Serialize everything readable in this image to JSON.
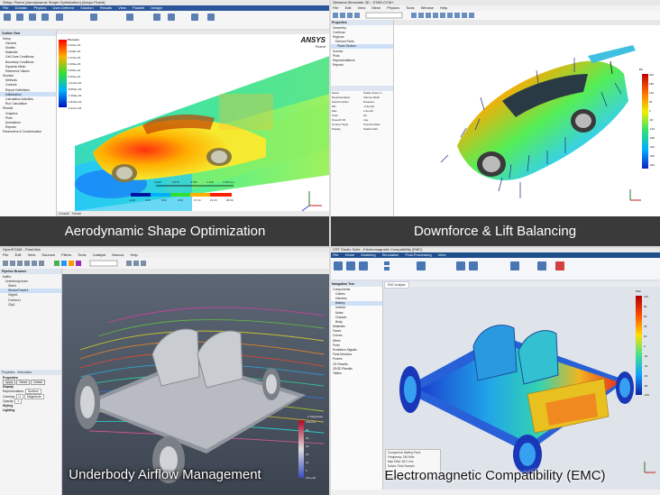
{
  "q1": {
    "title": "Setup: Fluent (Aerodynamic Shape Optimization) [Ansys Fluent]",
    "tabs": [
      "File",
      "Domain",
      "Physics",
      "User-Defined",
      "Solution",
      "Results",
      "View",
      "Parallel",
      "Design"
    ],
    "panel_title": "Outline View",
    "tree": [
      "Setup",
      "General",
      "Models",
      "Materials",
      "Cell Zone Conditions",
      "Boundary Conditions",
      "Dynamic Mesh",
      "Reference Values",
      "Solution",
      "Methods",
      "Controls",
      "Report Definitions",
      "Initialization",
      "Calculation Activities",
      "Run Calculation",
      "Results",
      "Graphics",
      "Plots",
      "Animations",
      "Reports",
      "Parameters & Customization"
    ],
    "view_tab": "Mesh",
    "brand": "ANSYS",
    "brand_sub": "Fluent",
    "legend_title": "Pressure",
    "legend_values": [
      "2.422e+03",
      "1.948e+03",
      "1.474e+03",
      "1.000e+03",
      "5.265e+02",
      "5.264e+01",
      "-4.212e+02",
      "-8.952e+02",
      "-1.369e+03",
      "-1.843e+03",
      "-2.317e+03"
    ],
    "scale_ticks": [
      "0.000",
      "0.375",
      "0.750",
      "1.125",
      "1.500 (m)"
    ],
    "bottom_ticks": [
      "-1.00",
      "2.00",
      "0.00",
      "2.00",
      "17.14",
      "21.15",
      "28.00"
    ],
    "bottom_tabs": [
      "Console",
      "Tutorial"
    ],
    "caption": "Aerodynamic Shape Optimization"
  },
  "q2": {
    "title": "Siemens Simcenter 3D - STAR-CCM+",
    "menu": [
      "File",
      "Edit",
      "View",
      "Mesh",
      "Physics",
      "Tools",
      "Window",
      "Help"
    ],
    "panel_title": "Properties",
    "tree": [
      "Geometry",
      "Continua",
      "Regions",
      "Derived Parts",
      "Plane Section",
      "Scenes",
      "Plots",
      "Representations",
      "Reports"
    ],
    "props": [
      [
        "Name",
        "Scalar Scene 1"
      ],
      [
        "Representation",
        "Volume Mesh"
      ],
      [
        "Field Function",
        "Pressure"
      ],
      [
        "Min",
        "-3.4e+02"
      ],
      [
        "Max",
        "2.4e+02"
      ],
      [
        "Units",
        "Pa"
      ],
      [
        "Smooth Fill",
        "true"
      ],
      [
        "Contour Style",
        "Smooth Filled"
      ],
      [
        "Display",
        "Scalar Field"
      ]
    ],
    "legend_title": "Pa",
    "legend_values": [
      "240",
      "180",
      "120",
      "60",
      "0",
      "-60",
      "-120",
      "-180",
      "-240",
      "-300",
      "-340"
    ],
    "caption": "Downforce & Lift Balancing"
  },
  "q3": {
    "title": "OpenFOAM - ParaView",
    "menu": [
      "File",
      "Edit",
      "View",
      "Sources",
      "Filters",
      "Tools",
      "Catalyst",
      "Macros",
      "Help"
    ],
    "panel_title": "Pipeline Browser",
    "tree": [
      "builtin:",
      "Underbody.foam",
      "Slice1",
      "StreamTracer1",
      "Glyph1",
      "Contour1",
      "Clip1"
    ],
    "prop_tabs": [
      "Properties",
      "Information"
    ],
    "props": [
      "Properties",
      "Apply",
      "Reset",
      "Delete",
      "Display",
      "Representation",
      "Surface",
      "Coloring",
      "U",
      "Magnitude",
      "Opacity",
      "1",
      "Styling",
      "Lighting"
    ],
    "legend_title": "U Magnitude",
    "legend_values": [
      "3.5e+01",
      "30",
      "25",
      "20",
      "15",
      "10",
      "5",
      "0.0e+00"
    ],
    "caption": "Underbody Airflow Management"
  },
  "q4": {
    "title": "CST Studio Suite - Electromagnetic Compatibility (EMC)",
    "tabs": [
      "File",
      "Home",
      "Modeling",
      "Simulation",
      "Post-Processing",
      "View"
    ],
    "panel_title": "Navigation Tree",
    "tree": [
      "Components",
      "Cables",
      "Harness",
      "Battery",
      "Inverter",
      "Motor",
      "Chassis",
      "Body",
      "Materials",
      "Faces",
      "Curves",
      "Wires",
      "Ports",
      "Excitation Signals",
      "Field Monitors",
      "Probes",
      "1D Results",
      "2D/3D Results",
      "Tables"
    ],
    "view_tab": "EMC Analysis",
    "legend_title": "V/m",
    "legend_values": [
      "100",
      "80",
      "60",
      "40",
      "20",
      "0",
      "-20",
      "-40",
      "-60",
      "-80",
      "-100"
    ],
    "info_rows": [
      "Component: Battery Pack",
      "Frequency: 150 MHz",
      "Max Field: 98.2 V/m",
      "Solver: Time Domain"
    ],
    "caption": "Electromagnetic Compatibility (EMC)"
  },
  "colors": {
    "ansys_bg": "#ffffff",
    "star_bg": "#ffffff",
    "paraview_bg": "#505a66",
    "cst_bg": "#dfe3ea",
    "caption_bar": "#3a3a3a"
  }
}
